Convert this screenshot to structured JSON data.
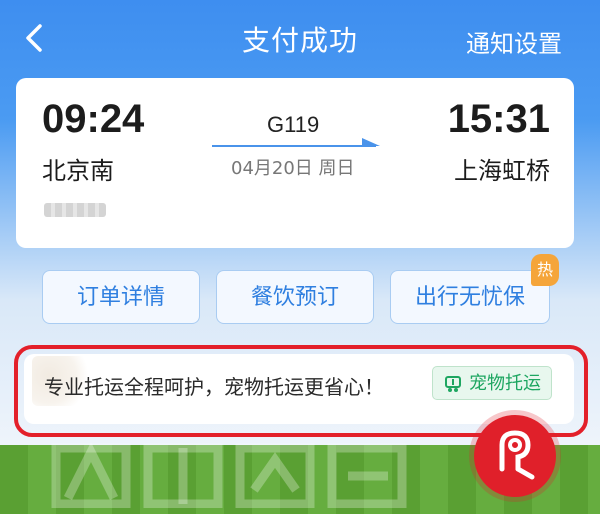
{
  "header": {
    "title": "支付成功",
    "right_link": "通知设置"
  },
  "ticket": {
    "departure_time": "09:24",
    "arrival_time": "15:31",
    "departure_station": "北京南",
    "arrival_station": "上海虹桥",
    "train_number": "G119",
    "date": "04月20日 周日"
  },
  "actions": {
    "order_details": "订单详情",
    "meal_booking": "餐饮预订",
    "travel_insurance": "出行无忧保",
    "hot_badge": "热"
  },
  "banner": {
    "slogan": "专业托运全程呵护，宠物托运更省心！",
    "pet_button": "宠物托运"
  },
  "colors": {
    "accent_blue": "#3e8ef0",
    "highlight_red": "#e3202a",
    "pet_green": "#1ea661",
    "hot_orange": "#f5a53a"
  }
}
